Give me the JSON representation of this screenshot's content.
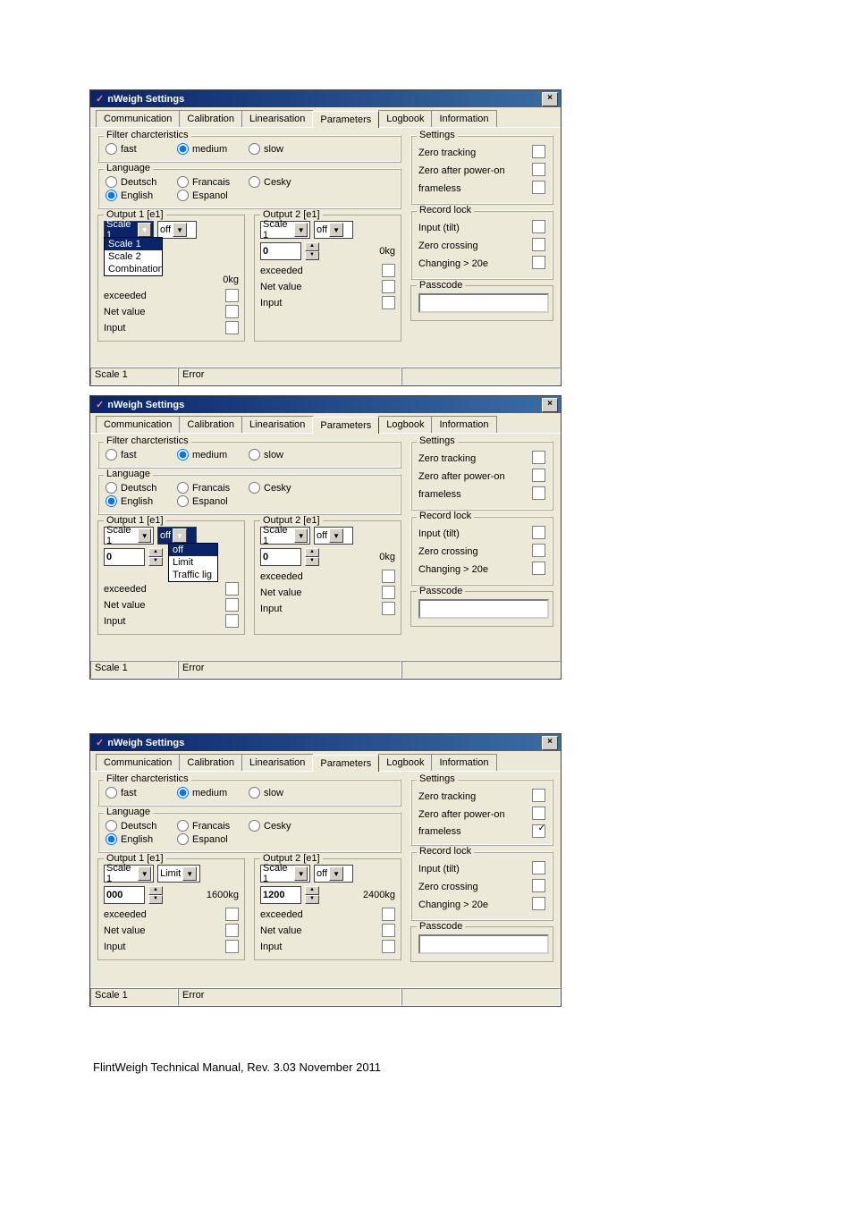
{
  "dialog_title": "nWeigh Settings",
  "tabs": [
    "Communication",
    "Calibration",
    "Linearisation",
    "Parameters",
    "Logbook",
    "Information"
  ],
  "active_tab": "Parameters",
  "filter_group": "Filter charcteristics",
  "radio_fast": "fast",
  "radio_medium": "medium",
  "radio_slow": "slow",
  "language_group": "Language",
  "lang_deutsch": "Deutsch",
  "lang_francais": "Francais",
  "lang_cesky": "Cesky",
  "lang_english": "English",
  "lang_espanol": "Espanol",
  "output1_legend": "Output 1 [e1]",
  "output2_legend": "Output 2 [e1]",
  "scale1": "Scale 1",
  "scale2": "Scale 2",
  "combination": "Combination",
  "off": "off",
  "limit": "Limit",
  "traffic": "Traffic lig",
  "zero_kg": "0kg",
  "exceeded": "exceeded",
  "netvalue": "Net value",
  "input_lbl": "Input",
  "settings_group": "Settings",
  "zero_tracking": "Zero tracking",
  "zero_after": "Zero after power-on",
  "frameless": "frameless",
  "recordlock_group": "Record lock",
  "input_tilt": "Input (tilt)",
  "zero_crossing": "Zero crossing",
  "changing": "Changing > 20e",
  "passcode_group": "Passcode",
  "status_scale": "Scale 1",
  "status_error": "Error",
  "d3_spin1": "000",
  "d3_weight1": "1600kg",
  "d3_spin2": "1200",
  "d3_weight2": "2400kg",
  "spin_zero": "0",
  "footer_text": "FlintWeigh Technical Manual, Rev. 3.03   November 2011"
}
